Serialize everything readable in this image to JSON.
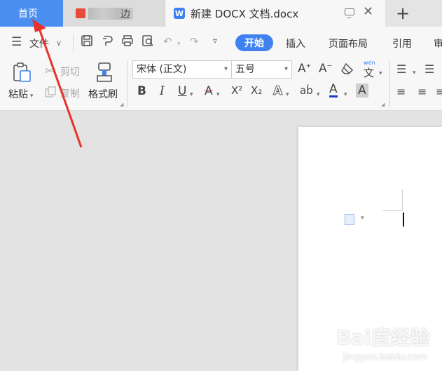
{
  "tabs": {
    "home": "首页",
    "second_tab_suffix": "边",
    "document": "新建 DOCX 文档.docx",
    "new_tab": "+"
  },
  "quick": {
    "menu_icon": "menu-icon",
    "file": "文件"
  },
  "ribbon_tabs": [
    "开始",
    "插入",
    "页面布局",
    "引用",
    "审"
  ],
  "clipboard": {
    "paste": "粘贴",
    "cut": "剪切",
    "copy": "复制",
    "format_painter": "格式刷"
  },
  "font": {
    "name": "宋体 (正文)",
    "size": "五号"
  },
  "format_buttons": {
    "bold": "B",
    "italic": "I",
    "underline": "U",
    "strike": "A",
    "superscript": "X²",
    "subscript": "X₂",
    "text_effect": "A",
    "phonetic": "ab́",
    "font_color": "A",
    "char_shade": "A",
    "grow": "A⁺",
    "shrink": "A⁻",
    "pinyin": "wén",
    "pinyin_char": "文"
  },
  "watermark": {
    "brand": "Bai度经验",
    "url": "jingyan.baidu.com"
  },
  "colors": {
    "accent": "#3f82ef",
    "home_tab": "#4a8ef0",
    "arrow": "#e8322b"
  }
}
